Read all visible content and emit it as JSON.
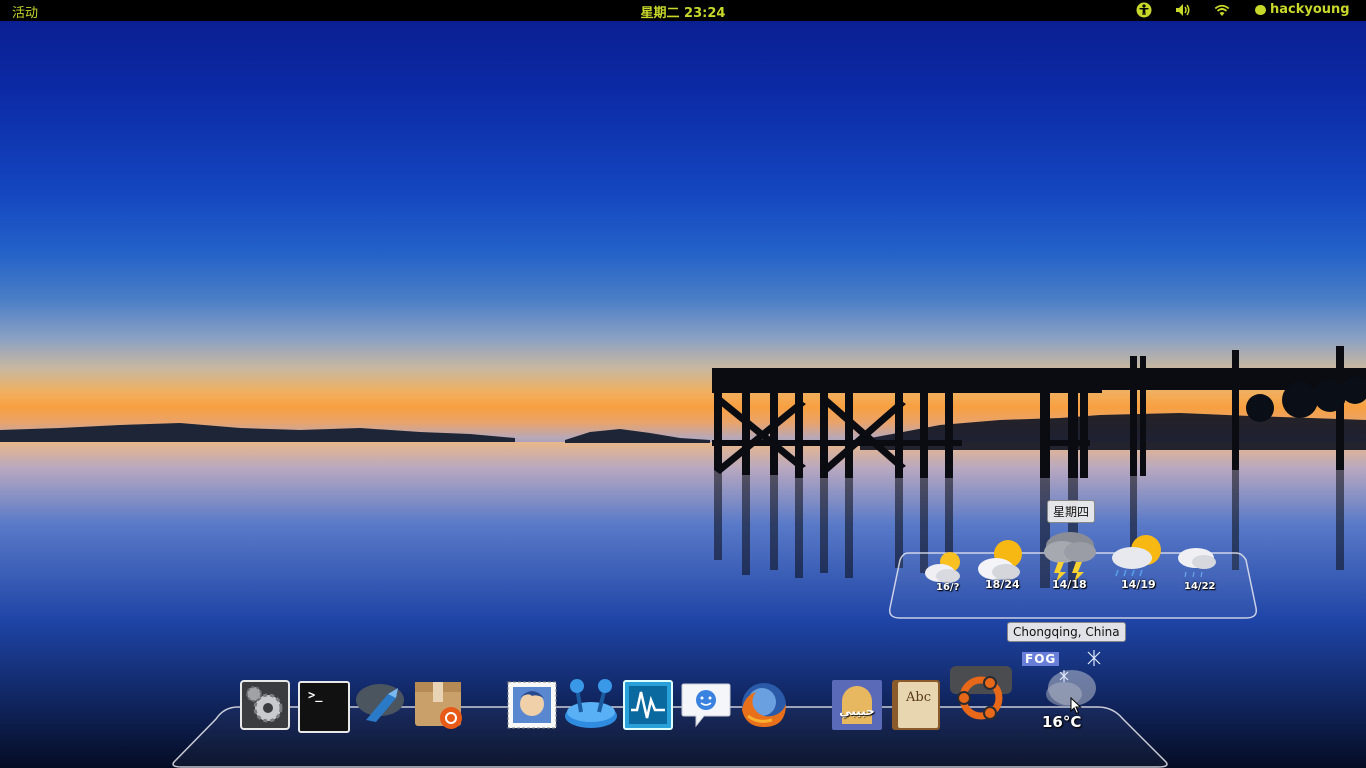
{
  "topbar": {
    "activities_label": "活动",
    "clock": "星期二 23:24",
    "username": "hackyoung",
    "accent_color": "#c7d82b",
    "tray_icons": [
      "accessibility-icon",
      "volume-icon",
      "wifi-icon"
    ]
  },
  "weather": {
    "tooltip_day": "星期四",
    "location": "Chongqing, China",
    "condition_badge": "FOG",
    "current_temp": "16°C",
    "forecast": [
      {
        "temp": "16/?",
        "icon": "partly-sunny-icon"
      },
      {
        "temp": "18/24",
        "icon": "sunny-cloudy-icon"
      },
      {
        "temp": "14/18",
        "icon": "thunderstorm-icon"
      },
      {
        "temp": "14/19",
        "icon": "sunny-rain-icon"
      },
      {
        "temp": "14/22",
        "icon": "cloudy-rain-icon"
      }
    ]
  },
  "dock": {
    "items": [
      {
        "name": "system-settings-icon"
      },
      {
        "name": "terminal-icon",
        "glyph": ">_"
      },
      {
        "name": "app-launcher-icon"
      },
      {
        "name": "software-center-icon"
      },
      {
        "name": "mail-stamp-icon"
      },
      {
        "name": "joystick-icon"
      },
      {
        "name": "system-monitor-icon"
      },
      {
        "name": "chat-messenger-icon"
      },
      {
        "name": "firefox-icon"
      },
      {
        "name": "arabic-app-icon",
        "glyph": "حبيبي"
      },
      {
        "name": "dictionary-icon",
        "glyph": "Abc"
      },
      {
        "name": "ubuntu-logo-icon"
      },
      {
        "name": "weather-applet-icon"
      }
    ]
  }
}
